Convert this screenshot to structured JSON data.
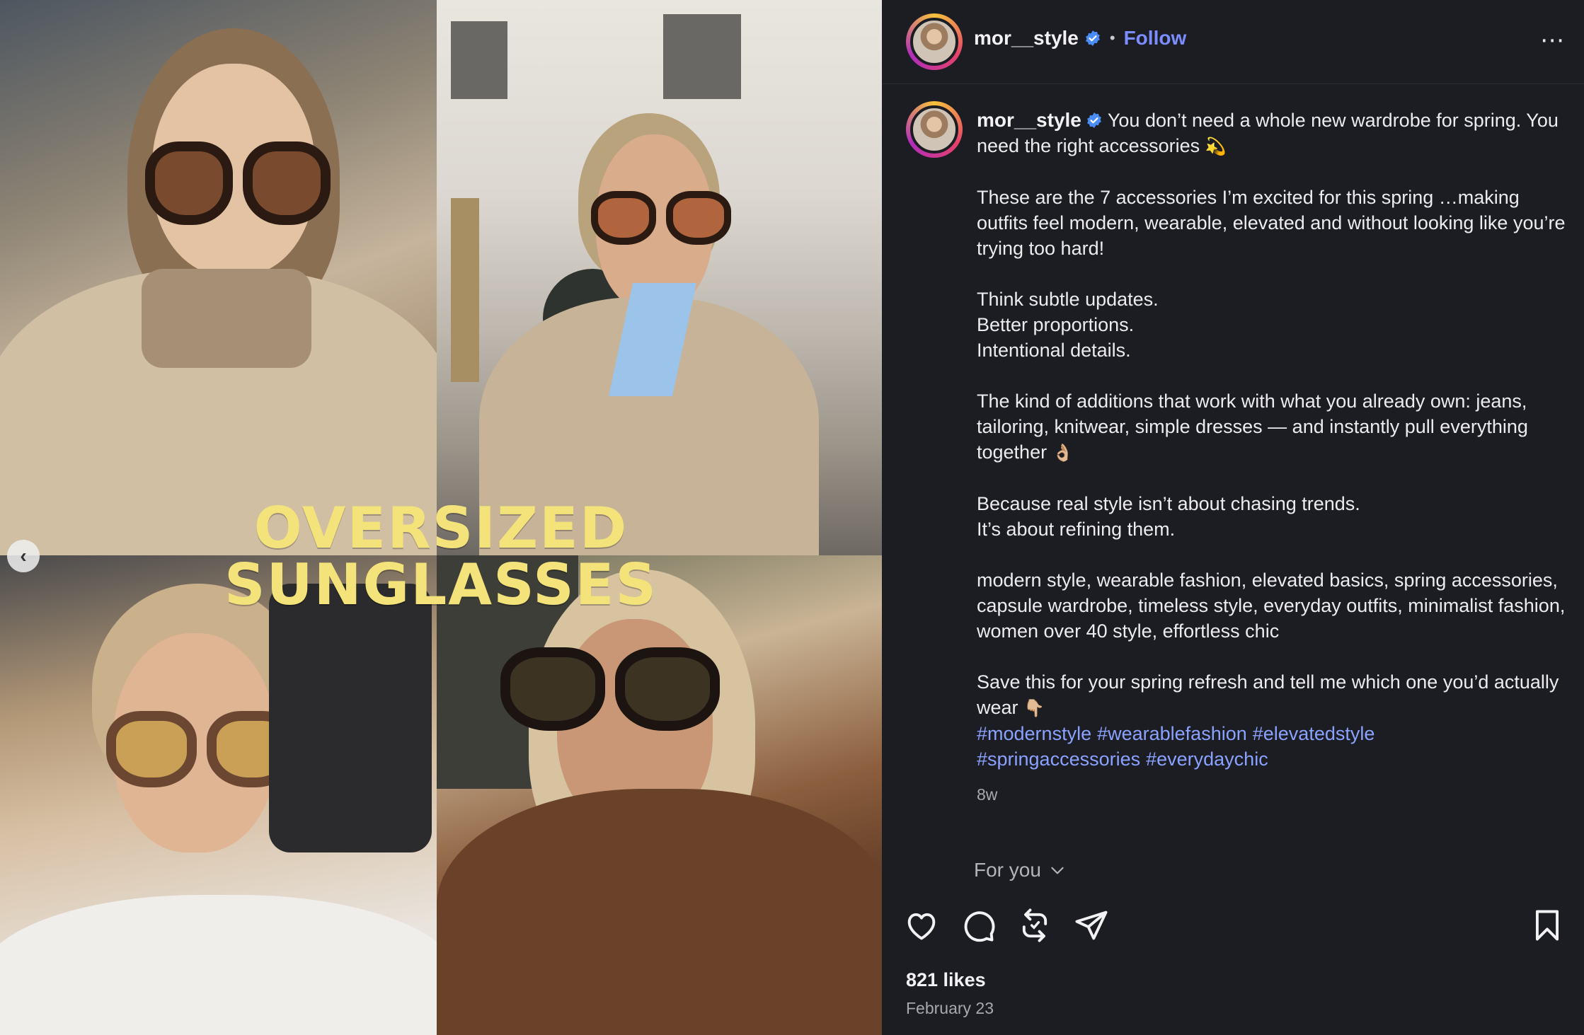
{
  "media": {
    "overlay_line1": "OVERSIZED",
    "overlay_line2": "SUNGLASSES",
    "overlay_color": "#f4e27a",
    "prev_icon": "chevron-left-icon",
    "prev_glyph": "‹"
  },
  "header": {
    "username": "mor__style",
    "separator": "•",
    "follow_label": "Follow",
    "follow_color": "#7b8dff",
    "more_glyph": "⋯"
  },
  "caption": {
    "username": "mor__style",
    "first_line": " You don’t need a whole new wardrobe for spring. You need the right accessories ",
    "first_emoji": "💫",
    "p2": "These are the 7 accessories I’m excited for this spring …making outfits feel modern, wearable, elevated and without looking like you’re trying too hard!",
    "p3_l1": "Think subtle updates.",
    "p3_l2": "Better proportions.",
    "p3_l3": "Intentional details.",
    "p4": "The kind of additions that work with what you already own: jeans, tailoring, knitwear, simple dresses — and instantly pull everything together ",
    "p4_emoji": "👌🏼",
    "p5_l1": "Because real style isn’t about chasing trends.",
    "p5_l2": "It’s about refining them.",
    "p6": "modern style, wearable fashion, elevated basics, spring accessories, capsule wardrobe, timeless style, everyday outfits, minimalist fashion, women over 40 style, effortless chic",
    "p7": "Save this for your spring refresh and tell me which one you’d actually wear ",
    "p7_emoji": "👇🏼",
    "hashtags": [
      "#modernstyle",
      "#wearablefashion",
      "#elevatedstyle",
      "#springaccessories",
      "#everydaychic"
    ],
    "time_ago": "8w",
    "hashtag_color": "#8aa2ff"
  },
  "feed_filter": {
    "label": "For you",
    "icon": "chevron-down-icon"
  },
  "actions": {
    "like_icon": "heart-icon",
    "comment_icon": "comment-icon",
    "repost_icon": "repost-icon",
    "share_icon": "send-icon",
    "save_icon": "bookmark-icon"
  },
  "stats": {
    "likes": "821 likes",
    "date": "February 23"
  }
}
